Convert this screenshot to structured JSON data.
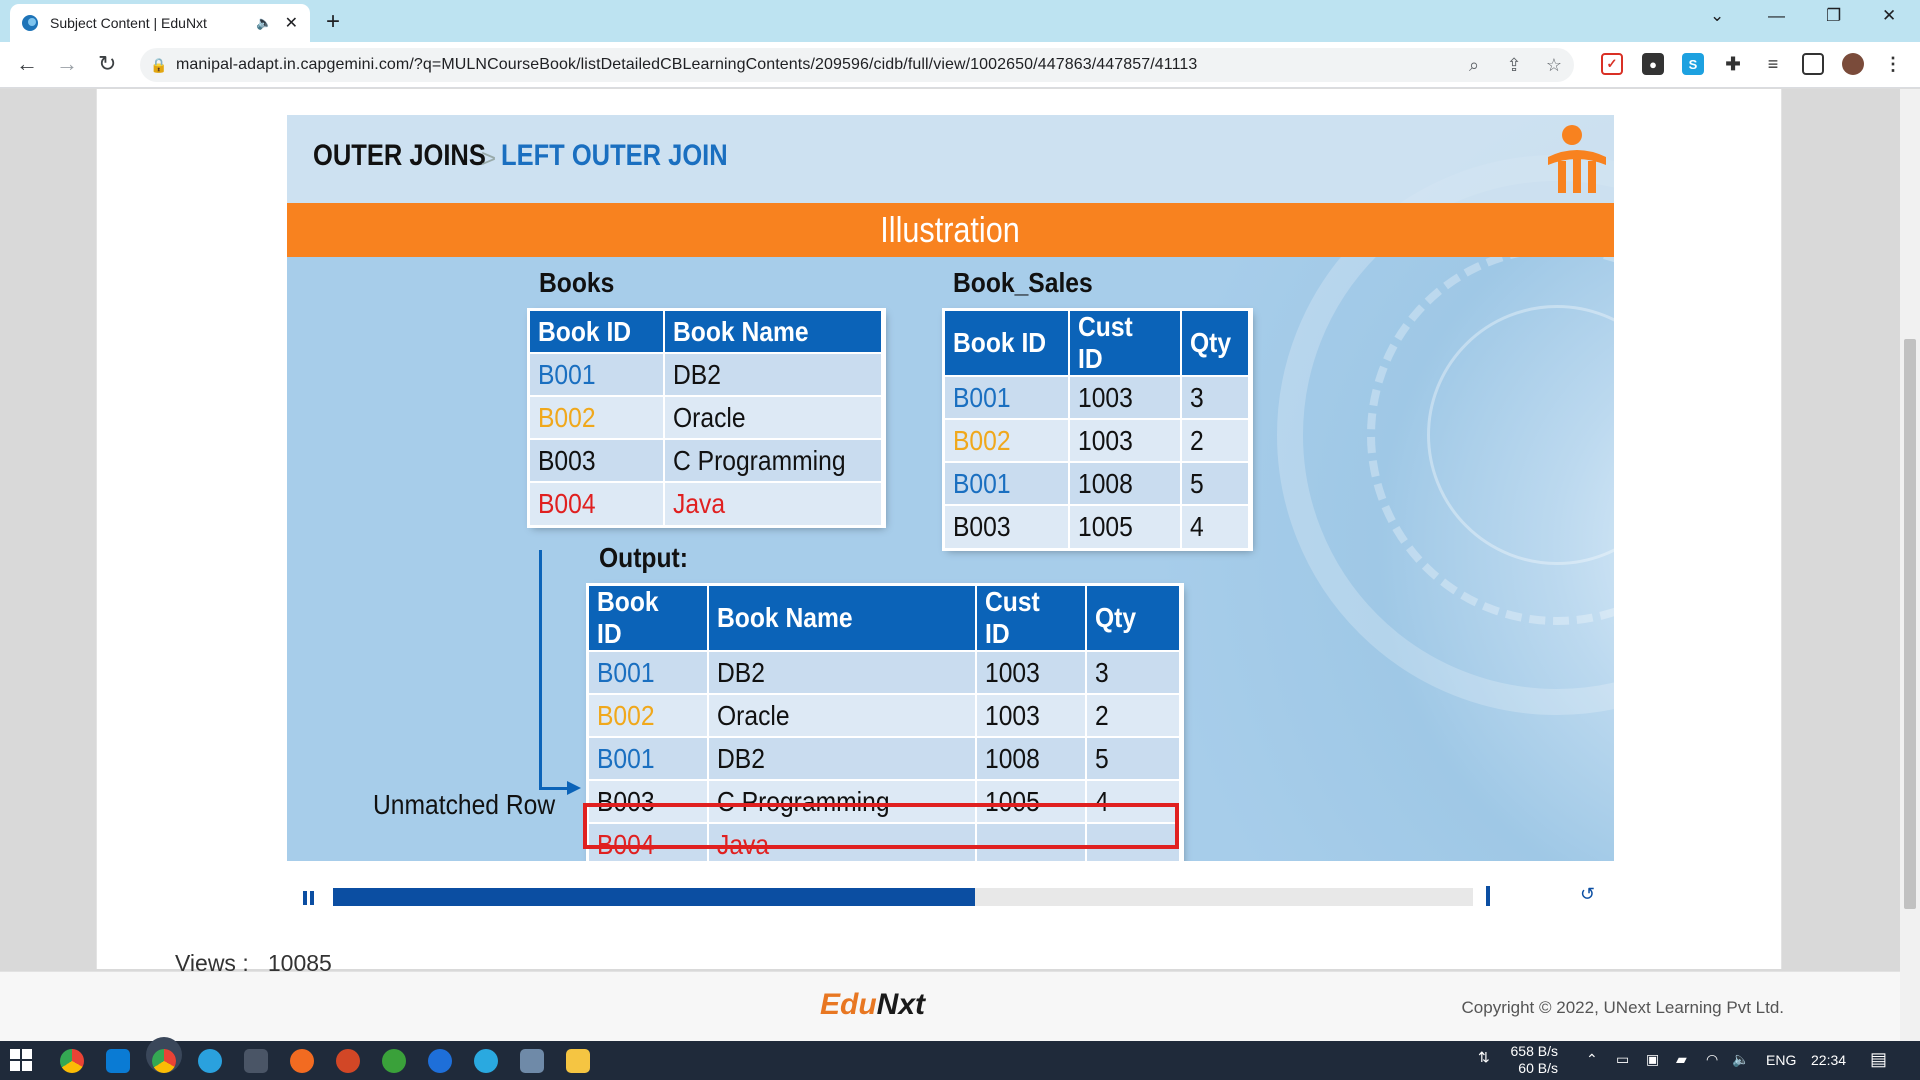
{
  "browser": {
    "tab_title": "Subject Content | EduNxt",
    "url": "manipal-adapt.in.capgemini.com/?q=MULNCourseBook/listDetailedCBLearningContents/209596/cidb/full/view/1002650/447863/447857/41113"
  },
  "slide": {
    "title_main": "OUTER JOINS",
    "title_separator": ">",
    "title_sub": "LEFT OUTER JOIN",
    "band": "Illustration",
    "books_label": "Books",
    "books_table": {
      "headers": [
        "Book ID",
        "Book Name"
      ],
      "rows": [
        [
          "B001",
          "DB2"
        ],
        [
          "B002",
          "Oracle"
        ],
        [
          "B003",
          "C Programming"
        ],
        [
          "B004",
          "Java"
        ]
      ]
    },
    "sales_label": "Book_Sales",
    "sales_table": {
      "headers": [
        "Book ID",
        "Cust ID",
        "Qty"
      ],
      "rows": [
        [
          "B001",
          "1003",
          "3"
        ],
        [
          "B002",
          "1003",
          "2"
        ],
        [
          "B001",
          "1008",
          "5"
        ],
        [
          "B003",
          "1005",
          "4"
        ]
      ]
    },
    "output_label": "Output:",
    "output_table": {
      "headers": [
        "Book ID",
        "Book Name",
        "Cust ID",
        "Qty"
      ],
      "rows": [
        [
          "B001",
          "DB2",
          "1003",
          "3"
        ],
        [
          "B002",
          "Oracle",
          "1003",
          "2"
        ],
        [
          "B001",
          "DB2",
          "1008",
          "5"
        ],
        [
          "B003",
          "C Programming",
          "1005",
          "4"
        ],
        [
          "B004",
          "Java",
          "-",
          "-"
        ]
      ]
    },
    "unmatched_label": "Unmatched Row",
    "id_colors": {
      "B001": "#1a6fc0",
      "B002": "#f0a81c",
      "B003": "#111111",
      "B004": "#e02020"
    }
  },
  "player": {
    "progress": 0.563
  },
  "views": {
    "label": "Views :",
    "value": "10085"
  },
  "footer": {
    "brand_a": "Edu",
    "brand_b": "Nxt",
    "copyright": "Copyright © 2022, UNext Learning Pvt Ltd."
  },
  "taskbar": {
    "net_down": "658 B/s",
    "net_up": "60 B/s",
    "lang": "ENG",
    "time": "22:34"
  },
  "colors": {
    "accent_blue": "#0b63b8",
    "band_orange": "#f8821f",
    "unmatched_red": "#e02020"
  }
}
